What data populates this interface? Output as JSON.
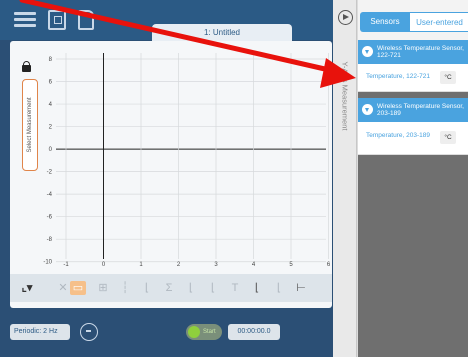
{
  "document": {
    "title": "1: Untitled"
  },
  "graph": {
    "y_axis_button": "Select Measurement",
    "y_ticks": [
      "8",
      "6",
      "4",
      "2",
      "0",
      "-2",
      "-4",
      "-6",
      "-8",
      "-10"
    ],
    "x_ticks": [
      "-1",
      "0",
      "1",
      "2",
      "3",
      "4",
      "5",
      "6"
    ]
  },
  "bottom": {
    "period_label": "Periodic: 2 Hz",
    "start_label": "Start",
    "time_value": "00:00:00.0"
  },
  "side": {
    "y_axis_label": "Y-Axis Measurement",
    "tabs": [
      {
        "label": "Sensors",
        "active": true
      },
      {
        "label": "User-entered",
        "active": false
      }
    ],
    "sensors": [
      {
        "name": "Wireless Temperature Sensor, 122-721",
        "measurement": "Temperature, 122-721",
        "unit": "°C"
      },
      {
        "name": "Wireless Temperature Sensor, 203-189",
        "measurement": "Temperature, 203-189",
        "unit": "°C"
      }
    ]
  },
  "colors": {
    "app_background": "#2b4f75",
    "accent_blue": "#4aa3df",
    "button_outline": "#e0854a",
    "annotation_arrow": "#e8120c",
    "start_green": "#8fcf3c"
  }
}
